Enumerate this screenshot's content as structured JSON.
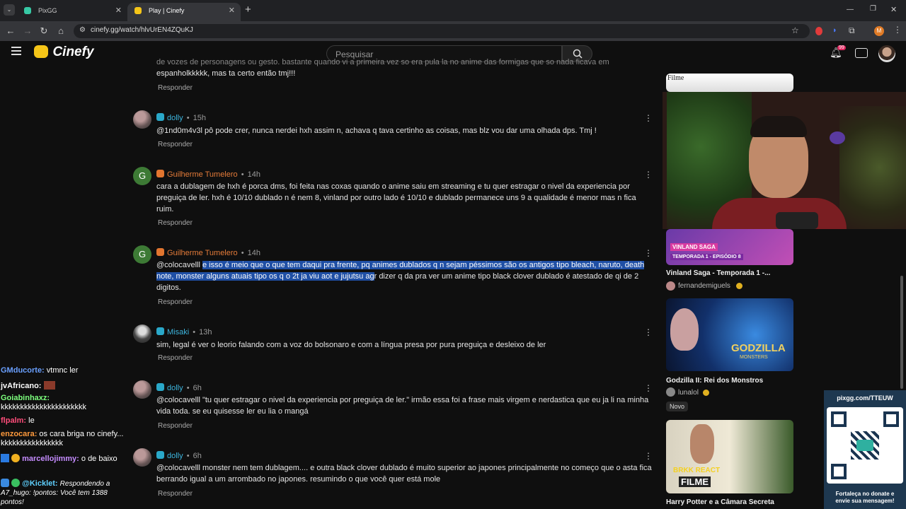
{
  "browser": {
    "tabs": [
      {
        "title": "PixGG"
      },
      {
        "title": "Play | Cinefy"
      }
    ],
    "new_tab": "+",
    "url": "cinefy.gg/watch/hlvUrEN4ZQuKJ",
    "window_controls": {
      "minimize": "—",
      "maximize": "❐",
      "close": "✕"
    },
    "notif_count": "99"
  },
  "site": {
    "logo": "Cinefy",
    "search_placeholder": "Pesquisar",
    "icons": {
      "menu": "menu-icon",
      "search": "search-icon",
      "bell": "bell-icon",
      "create": "video-plus-icon"
    }
  },
  "comments": {
    "top_partial": {
      "body": "espanholkkkkk, mas ta certo então tmj!!!",
      "reply": "Responder"
    },
    "items": [
      {
        "user": "dolly",
        "time": "15h",
        "body": "@1nd0m4v3l pô pode crer, nunca nerdei hxh assim n, achava q tava certinho as coisas, mas blz vou dar uma olhada dps. Tmj !",
        "reply": "Responder"
      },
      {
        "user": "Guilherme Tumelero",
        "time": "14h",
        "body": "cara a dublagem de hxh é porca dms, foi feita nas coxas quando o anime saiu em streaming e tu quer estragar o nivel da experiencia por preguiça de ler. hxh é 10/10 dublado n é nem 8, vinland por outro lado é 10/10 e dublado permanece uns 9 a qualidade é menor mas n fica ruim.",
        "reply": "Responder"
      },
      {
        "user": "Guilherme Tumelero",
        "time": "14h",
        "body_pre": "@colocavelll ",
        "body_hl": "e isso é meio que o que tem daqui pra frente, pq animes dublados q n sejam péssimos são os antigos tipo bleach, naruto, death note, monster alguns atuais tipo os q o 2t ja viu aot e jujutsu ag",
        "body_post": "r dizer q da pra ver um anime tipo black clover dublado é atestado de qi de 2 digitos.",
        "reply": "Responder"
      },
      {
        "user": "Misaki",
        "time": "13h",
        "body": "sim, legal é ver o leorio falando com a voz do bolsonaro e com a língua presa por pura preguiça e desleixo de ler",
        "reply": "Responder"
      },
      {
        "user": "dolly",
        "time": "6h",
        "body": "@colocavelll \"tu quer estragar o nivel da experiencia por preguiça de ler.\" irmão essa foi a frase mais virgem e nerdastica que eu ja li na minha vida toda. se eu quisesse ler eu lia o mangá",
        "reply": "Responder"
      },
      {
        "user": "dolly",
        "time": "6h",
        "body": "@colocavelll monster nem tem dublagem.... e outra black clover dublado é muito superior ao japones principalmente no começo que o asta fica berrando igual a um arrombado no japones. resumindo o que você quer está mole",
        "reply": "Responder"
      }
    ],
    "sep": "•"
  },
  "sidebar": {
    "videos": [
      {
        "thumb_text": "Filme",
        "title": "",
        "channel": ""
      },
      {
        "thumb_text": "VINLAND SAGA",
        "thumb_sub": "TEMPORADA 1 - EPISÓDIO 8",
        "title": "Vinland Saga - Temporada 1 -...",
        "channel": "fernandemiguels"
      },
      {
        "thumb_text": "GODZILLA",
        "thumb_sub": "MONSTERS",
        "title": "Godzilla II: Rei dos Monstros",
        "channel": "lunalol",
        "badge": "Novo"
      },
      {
        "thumb_text": "BRKK REACT",
        "thumb_sub": "FILME",
        "title": "Harry Potter e a Câmara Secreta",
        "channel": ""
      }
    ]
  },
  "chat": [
    {
      "user": "GMducorte:",
      "color": "#6aa0ff",
      "msg": "vtmnc ler"
    },
    {
      "user": "jvAfricano:",
      "color": "#ffffff",
      "msg": ""
    },
    {
      "user": "Goiabinhaxz:",
      "color": "#7dff7d",
      "msg": "kkkkkkkkkkkkkkkkkkkkkk"
    },
    {
      "user": "flpalm:",
      "color": "#ff4d7a",
      "msg": "le"
    },
    {
      "user": "enzocara:",
      "color": "#ff9a3c",
      "msg": "os cara briga no cinefy... kkkkkkkkkkkkkkkk"
    },
    {
      "user": "marcellojimmy:",
      "color": "#c58cff",
      "msg": "o de baixo"
    },
    {
      "user": "@Kicklet:",
      "color": "#5fd0ff",
      "msg": "Respondendo a A7_hugo: !pontos: Você tem 1388 pontos!"
    }
  ],
  "qr": {
    "url": "pixgg.com/TTEUW",
    "caption": "Fortaleça no donate e envie sua mensagem!"
  }
}
